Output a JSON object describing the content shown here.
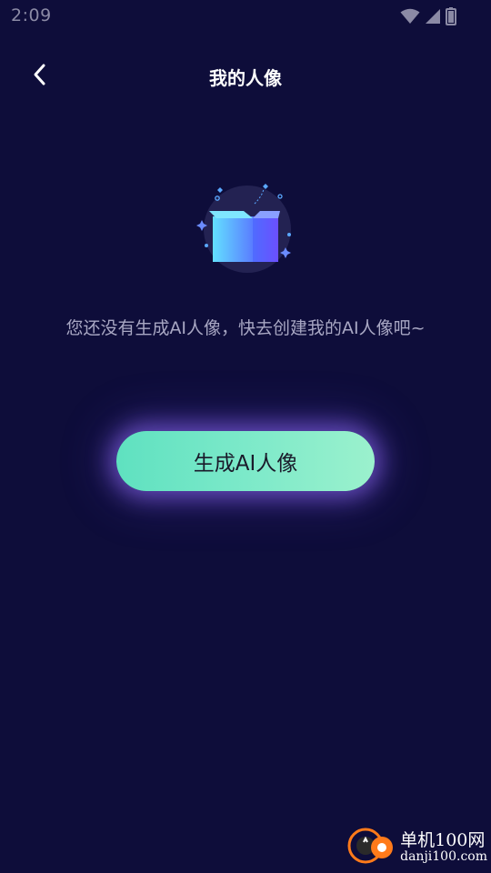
{
  "status_bar": {
    "time": "2:09",
    "icons": [
      "wifi-icon",
      "signal-icon",
      "battery-icon"
    ]
  },
  "header": {
    "back_icon": "chevron-left-icon",
    "title": "我的人像"
  },
  "empty_state": {
    "illustration": "open-box-icon",
    "message": "您还没有生成AI人像，快去创建我的AI人像吧~"
  },
  "actions": {
    "generate_label": "生成AI人像"
  },
  "watermark": {
    "title": "单机100网",
    "url": "danji100.com"
  },
  "colors": {
    "background": "#0e0d3a",
    "button_start": "#5fe1c0",
    "button_end": "#9bf1cd",
    "accent_blue": "#5aa8ff"
  }
}
